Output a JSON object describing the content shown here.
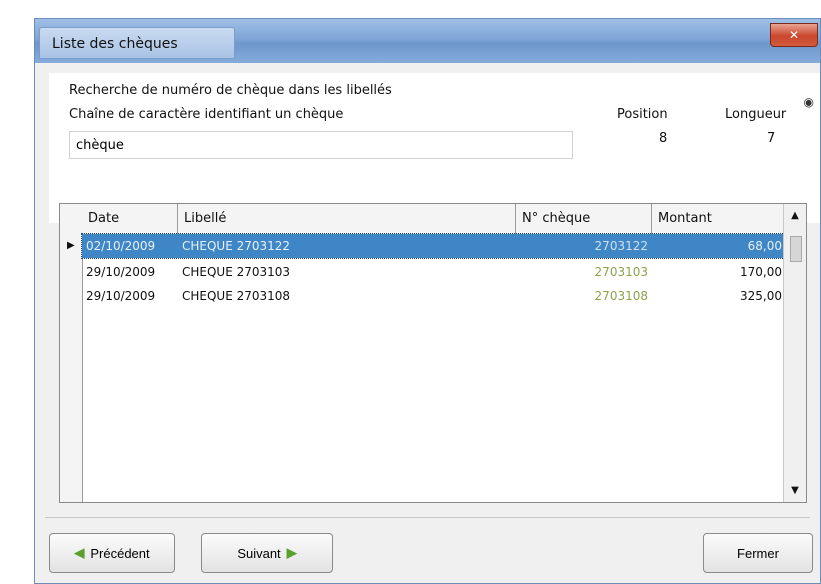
{
  "window": {
    "title": "Liste des chèques",
    "close_label": "✕"
  },
  "search": {
    "label_line1": "Recherche de numéro de chèque dans les libellés",
    "label_line2": "Chaîne de caractère identifiant un chèque",
    "query_value": "chèque",
    "corner_mark": "◉",
    "position_label": "Position",
    "position_value": "8",
    "length_label": "Longueur",
    "length_value": "7"
  },
  "table": {
    "columns": [
      "Date",
      "Libellé",
      "N° chèque",
      "Montant"
    ],
    "rows": [
      {
        "date": "02/10/2009",
        "libelle": "CHEQUE 2703122",
        "cheque": "2703122",
        "montant": "68,00",
        "selected": true
      },
      {
        "date": "29/10/2009",
        "libelle": "CHEQUE 2703103",
        "cheque": "2703103",
        "montant": "170,00",
        "selected": false
      },
      {
        "date": "29/10/2009",
        "libelle": "CHEQUE 2703108",
        "cheque": "2703108",
        "montant": "325,00",
        "selected": false
      }
    ],
    "row_marker": "▶",
    "scroll_up": "▲",
    "scroll_down": "▼"
  },
  "buttons": {
    "previous_label": "Précédent",
    "next_label": "Suivant",
    "close_label": "Fermer",
    "previous_arrow": "◀",
    "next_arrow": "▶"
  }
}
